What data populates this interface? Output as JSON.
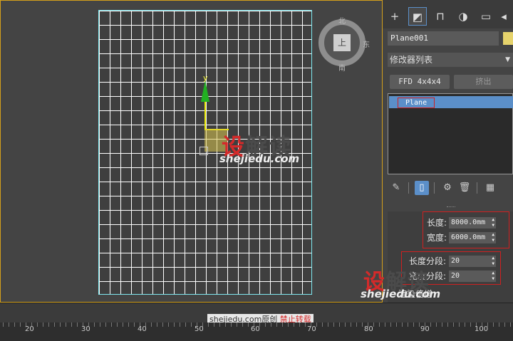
{
  "viewport": {
    "compass": {
      "north": "北",
      "east": "东",
      "south": "南"
    },
    "viewcube_face": "上",
    "gizmo_axis_label": "y"
  },
  "watermark": {
    "logo_red": "设",
    "logo_rest": "解读",
    "url": "shejiedu.com",
    "footer_prefix": "shejiedu.com原创",
    "footer_warning": "禁止转载"
  },
  "command_panel": {
    "tabs": [
      "create-icon",
      "modify-icon",
      "hierarchy-icon",
      "motion-icon",
      "display-icon"
    ],
    "object_name": "Plane001",
    "object_color": "#e6d36c",
    "modifier_list_label": "修改器列表",
    "buttons": {
      "ffd": "FFD 4x4x4",
      "extrude": "挤出"
    },
    "stack_items": [
      "Plane"
    ]
  },
  "parameters": {
    "length_label": "长度:",
    "length_value": "8000.0mm",
    "width_label": "宽度:",
    "width_value": "6000.0mm",
    "length_segs_label": "长度分段:",
    "length_segs_value": "20",
    "width_segs_label": "宽度分段:",
    "width_segs_value": "20",
    "render_multipliers": "渲染倍增"
  },
  "timeline": {
    "ticks": [
      "20",
      "30",
      "40",
      "50",
      "60",
      "70",
      "80",
      "90",
      "100"
    ]
  },
  "colors": {
    "accent": "#5b8fc9",
    "viewport_border": "#d4a01c",
    "selection": "#7fe8f0",
    "annotation": "#d02020"
  }
}
